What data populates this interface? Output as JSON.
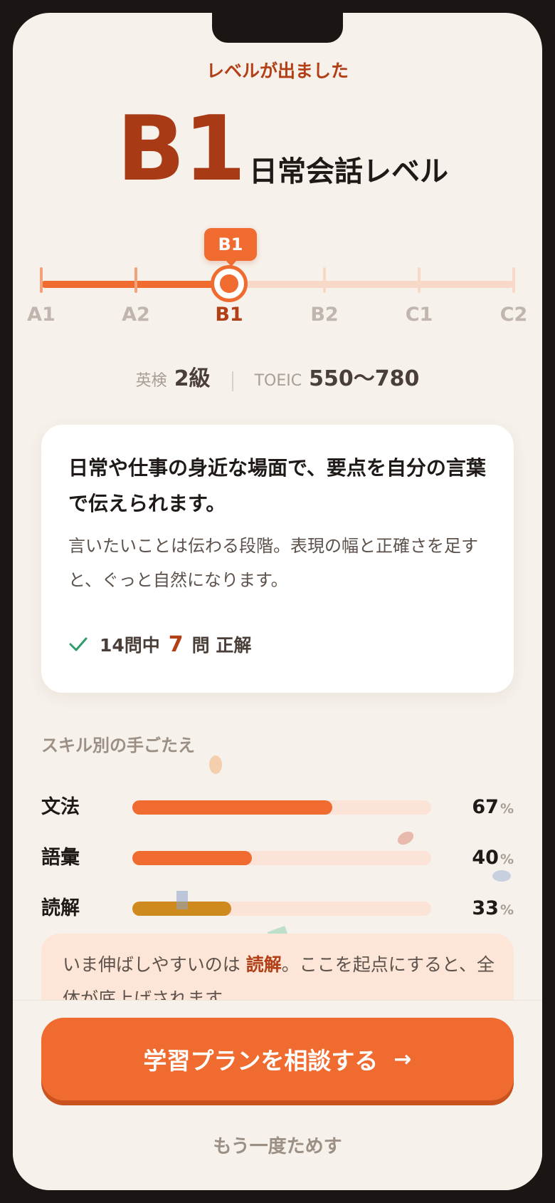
{
  "header": {
    "eyebrow": "レベルが出ました",
    "level": "B1",
    "level_name": "日常会話レベル"
  },
  "scale": {
    "current": "B1",
    "current_index": 2,
    "levels": [
      "A1",
      "A2",
      "B1",
      "B2",
      "C1",
      "C2"
    ],
    "pin_label": "B1"
  },
  "equivalents": {
    "eiken_label": "英検",
    "eiken_value": "2級",
    "toeic_label": "TOEIC",
    "toeic_value": "550〜780"
  },
  "summary": {
    "title": "日常や仕事の身近な場面で、要点を自分の言葉で伝えられます。",
    "body": "言いたいことは伝わる段階。表現の幅と正確さを足すと、ぐっと自然になります。",
    "check_icon": "check-icon",
    "score_prefix": "14問中",
    "score_correct": "7",
    "score_suffix": "問 正解"
  },
  "skills": {
    "title": "スキル別の手ごたえ",
    "items": [
      {
        "name": "文法",
        "percent": 67,
        "value": "67",
        "unit": "%"
      },
      {
        "name": "語彙",
        "percent": 40,
        "value": "40",
        "unit": "%"
      },
      {
        "name": "読解",
        "percent": 33,
        "value": "33",
        "unit": "%"
      }
    ]
  },
  "tip": {
    "prefix": "いま伸ばしやすいのは",
    "highlight": "読解",
    "suffix": "。ここを起点にすると、全体が底上げされます。"
  },
  "actions": {
    "primary_label": "学習プランを相談する",
    "primary_icon": "arrow-right-icon",
    "secondary_label": "もう一度ためす"
  },
  "colors": {
    "accent": "#ef6b30",
    "accent_dark": "#b23f16",
    "background": "#f6f1eb",
    "reading_bar": "#cf8a1f"
  }
}
